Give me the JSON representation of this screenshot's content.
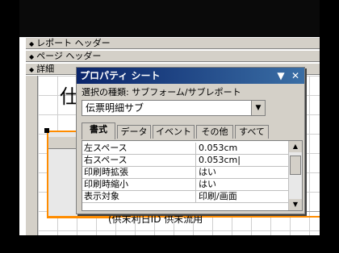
{
  "report": {
    "bands": [
      {
        "label": "レポート ヘッダー"
      },
      {
        "label": "ページ ヘッダー"
      },
      {
        "label": "詳細"
      }
    ],
    "title_char": "仕",
    "bottom_text": "(供末利日ID    供末流用"
  },
  "property_sheet": {
    "title": "プロパティ シート",
    "selection_type": "選択の種類: サブフォーム/サブレポート",
    "selected_object": "伝票明細サブ",
    "tabs": [
      {
        "label": "書式",
        "active": true
      },
      {
        "label": "データ"
      },
      {
        "label": "イベント"
      },
      {
        "label": "その他"
      },
      {
        "label": "すべて"
      }
    ],
    "properties": [
      {
        "name": "左スペース",
        "value": "0.053cm"
      },
      {
        "name": "右スペース",
        "value": "0.053cm|"
      },
      {
        "name": "印刷時拡張",
        "value": "はい"
      },
      {
        "name": "印刷時縮小",
        "value": "はい"
      },
      {
        "name": "表示対象",
        "value": "印刷/画面"
      }
    ]
  },
  "colors": {
    "titlebar": "#0a246a",
    "selection_outline": "#ff8c00",
    "panel_bg": "#d4d0c8"
  }
}
